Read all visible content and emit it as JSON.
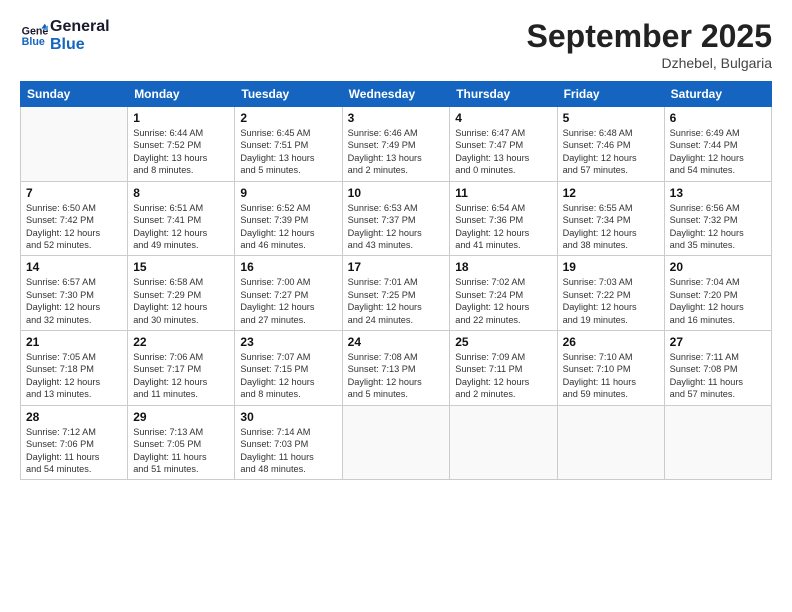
{
  "logo": {
    "line1": "General",
    "line2": "Blue"
  },
  "title": "September 2025",
  "location": "Dzhebel, Bulgaria",
  "days_header": [
    "Sunday",
    "Monday",
    "Tuesday",
    "Wednesday",
    "Thursday",
    "Friday",
    "Saturday"
  ],
  "weeks": [
    [
      {
        "num": "",
        "info": ""
      },
      {
        "num": "1",
        "info": "Sunrise: 6:44 AM\nSunset: 7:52 PM\nDaylight: 13 hours\nand 8 minutes."
      },
      {
        "num": "2",
        "info": "Sunrise: 6:45 AM\nSunset: 7:51 PM\nDaylight: 13 hours\nand 5 minutes."
      },
      {
        "num": "3",
        "info": "Sunrise: 6:46 AM\nSunset: 7:49 PM\nDaylight: 13 hours\nand 2 minutes."
      },
      {
        "num": "4",
        "info": "Sunrise: 6:47 AM\nSunset: 7:47 PM\nDaylight: 13 hours\nand 0 minutes."
      },
      {
        "num": "5",
        "info": "Sunrise: 6:48 AM\nSunset: 7:46 PM\nDaylight: 12 hours\nand 57 minutes."
      },
      {
        "num": "6",
        "info": "Sunrise: 6:49 AM\nSunset: 7:44 PM\nDaylight: 12 hours\nand 54 minutes."
      }
    ],
    [
      {
        "num": "7",
        "info": "Sunrise: 6:50 AM\nSunset: 7:42 PM\nDaylight: 12 hours\nand 52 minutes."
      },
      {
        "num": "8",
        "info": "Sunrise: 6:51 AM\nSunset: 7:41 PM\nDaylight: 12 hours\nand 49 minutes."
      },
      {
        "num": "9",
        "info": "Sunrise: 6:52 AM\nSunset: 7:39 PM\nDaylight: 12 hours\nand 46 minutes."
      },
      {
        "num": "10",
        "info": "Sunrise: 6:53 AM\nSunset: 7:37 PM\nDaylight: 12 hours\nand 43 minutes."
      },
      {
        "num": "11",
        "info": "Sunrise: 6:54 AM\nSunset: 7:36 PM\nDaylight: 12 hours\nand 41 minutes."
      },
      {
        "num": "12",
        "info": "Sunrise: 6:55 AM\nSunset: 7:34 PM\nDaylight: 12 hours\nand 38 minutes."
      },
      {
        "num": "13",
        "info": "Sunrise: 6:56 AM\nSunset: 7:32 PM\nDaylight: 12 hours\nand 35 minutes."
      }
    ],
    [
      {
        "num": "14",
        "info": "Sunrise: 6:57 AM\nSunset: 7:30 PM\nDaylight: 12 hours\nand 32 minutes."
      },
      {
        "num": "15",
        "info": "Sunrise: 6:58 AM\nSunset: 7:29 PM\nDaylight: 12 hours\nand 30 minutes."
      },
      {
        "num": "16",
        "info": "Sunrise: 7:00 AM\nSunset: 7:27 PM\nDaylight: 12 hours\nand 27 minutes."
      },
      {
        "num": "17",
        "info": "Sunrise: 7:01 AM\nSunset: 7:25 PM\nDaylight: 12 hours\nand 24 minutes."
      },
      {
        "num": "18",
        "info": "Sunrise: 7:02 AM\nSunset: 7:24 PM\nDaylight: 12 hours\nand 22 minutes."
      },
      {
        "num": "19",
        "info": "Sunrise: 7:03 AM\nSunset: 7:22 PM\nDaylight: 12 hours\nand 19 minutes."
      },
      {
        "num": "20",
        "info": "Sunrise: 7:04 AM\nSunset: 7:20 PM\nDaylight: 12 hours\nand 16 minutes."
      }
    ],
    [
      {
        "num": "21",
        "info": "Sunrise: 7:05 AM\nSunset: 7:18 PM\nDaylight: 12 hours\nand 13 minutes."
      },
      {
        "num": "22",
        "info": "Sunrise: 7:06 AM\nSunset: 7:17 PM\nDaylight: 12 hours\nand 11 minutes."
      },
      {
        "num": "23",
        "info": "Sunrise: 7:07 AM\nSunset: 7:15 PM\nDaylight: 12 hours\nand 8 minutes."
      },
      {
        "num": "24",
        "info": "Sunrise: 7:08 AM\nSunset: 7:13 PM\nDaylight: 12 hours\nand 5 minutes."
      },
      {
        "num": "25",
        "info": "Sunrise: 7:09 AM\nSunset: 7:11 PM\nDaylight: 12 hours\nand 2 minutes."
      },
      {
        "num": "26",
        "info": "Sunrise: 7:10 AM\nSunset: 7:10 PM\nDaylight: 11 hours\nand 59 minutes."
      },
      {
        "num": "27",
        "info": "Sunrise: 7:11 AM\nSunset: 7:08 PM\nDaylight: 11 hours\nand 57 minutes."
      }
    ],
    [
      {
        "num": "28",
        "info": "Sunrise: 7:12 AM\nSunset: 7:06 PM\nDaylight: 11 hours\nand 54 minutes."
      },
      {
        "num": "29",
        "info": "Sunrise: 7:13 AM\nSunset: 7:05 PM\nDaylight: 11 hours\nand 51 minutes."
      },
      {
        "num": "30",
        "info": "Sunrise: 7:14 AM\nSunset: 7:03 PM\nDaylight: 11 hours\nand 48 minutes."
      },
      {
        "num": "",
        "info": ""
      },
      {
        "num": "",
        "info": ""
      },
      {
        "num": "",
        "info": ""
      },
      {
        "num": "",
        "info": ""
      }
    ]
  ]
}
